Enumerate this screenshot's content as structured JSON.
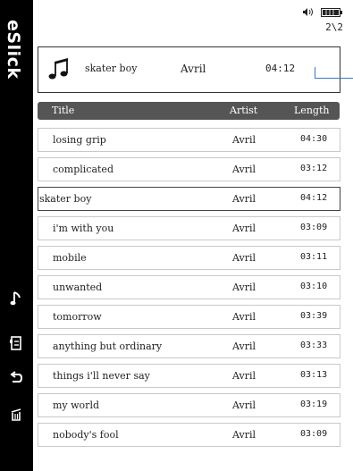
{
  "app": {
    "brand": "eSlick"
  },
  "status": {
    "page": "2\\2"
  },
  "now_playing": {
    "title": "skater boy",
    "artist": "Avril",
    "length": "04:12",
    "icon": "music-note-icon"
  },
  "table": {
    "headers": {
      "title": "Title",
      "artist": "Artist",
      "length": "Length"
    },
    "rows": [
      {
        "title": "losing grip",
        "artist": "Avril",
        "length": "04:30"
      },
      {
        "title": "complicated",
        "artist": "Avril",
        "length": "03:12"
      },
      {
        "title": "skater boy",
        "artist": "Avril",
        "length": "04:12",
        "selected": true
      },
      {
        "title": "i'm with you",
        "artist": "Avril",
        "length": "03:09"
      },
      {
        "title": "mobile",
        "artist": "Avril",
        "length": "03:11"
      },
      {
        "title": "unwanted",
        "artist": "Avril",
        "length": "03:10"
      },
      {
        "title": "tomorrow",
        "artist": "Avril",
        "length": "03:39"
      },
      {
        "title": "anything but ordinary",
        "artist": "Avril",
        "length": "03:33"
      },
      {
        "title": "things i'll never say",
        "artist": "Avril",
        "length": "03:13"
      },
      {
        "title": "my world",
        "artist": "Avril",
        "length": "03:19"
      },
      {
        "title": "nobody's fool",
        "artist": "Avril",
        "length": "03:09"
      }
    ]
  },
  "sidebar_icons": [
    "music-note-icon",
    "bookmark-icon",
    "back-icon",
    "delete-icon"
  ],
  "colors": {
    "sidebar": "#000000",
    "header": "#555555",
    "accent_line": "#3b78c4"
  }
}
